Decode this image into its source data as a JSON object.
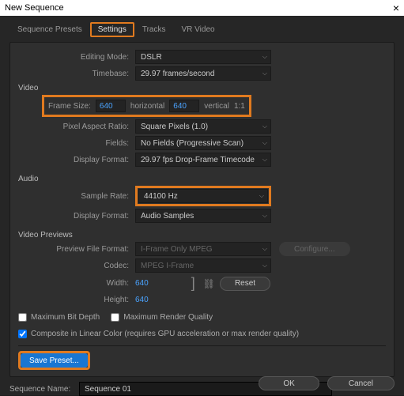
{
  "window": {
    "title": "New Sequence"
  },
  "tabs": {
    "presets": "Sequence Presets",
    "settings": "Settings",
    "tracks": "Tracks",
    "vr": "VR Video"
  },
  "editing": {
    "mode_label": "Editing Mode:",
    "mode_value": "DSLR",
    "timebase_label": "Timebase:",
    "timebase_value": "29.97 frames/second"
  },
  "video": {
    "heading": "Video",
    "framesize_label": "Frame Size:",
    "fs_w": "640",
    "fs_h": "640",
    "fs_horiz": "horizontal",
    "fs_vert": "vertical",
    "fs_ratio": "1:1",
    "par_label": "Pixel Aspect Ratio:",
    "par_value": "Square Pixels (1.0)",
    "fields_label": "Fields:",
    "fields_value": "No Fields (Progressive Scan)",
    "disp_label": "Display Format:",
    "disp_value": "29.97 fps Drop-Frame Timecode"
  },
  "audio": {
    "heading": "Audio",
    "rate_label": "Sample Rate:",
    "rate_value": "44100 Hz",
    "disp_label": "Display Format:",
    "disp_value": "Audio Samples"
  },
  "previews": {
    "heading": "Video Previews",
    "format_label": "Preview File Format:",
    "format_value": "I-Frame Only MPEG",
    "codec_label": "Codec:",
    "codec_value": "MPEG I-Frame",
    "width_label": "Width:",
    "width_value": "640",
    "height_label": "Height:",
    "height_value": "640",
    "configure": "Configure...",
    "reset": "Reset"
  },
  "checks": {
    "max_bit": "Maximum Bit Depth",
    "max_render": "Maximum Render Quality",
    "composite": "Composite in Linear Color (requires GPU acceleration or max render quality)"
  },
  "buttons": {
    "save_preset": "Save Preset...",
    "ok": "OK",
    "cancel": "Cancel"
  },
  "seq": {
    "label": "Sequence Name:",
    "value": "Sequence 01"
  }
}
